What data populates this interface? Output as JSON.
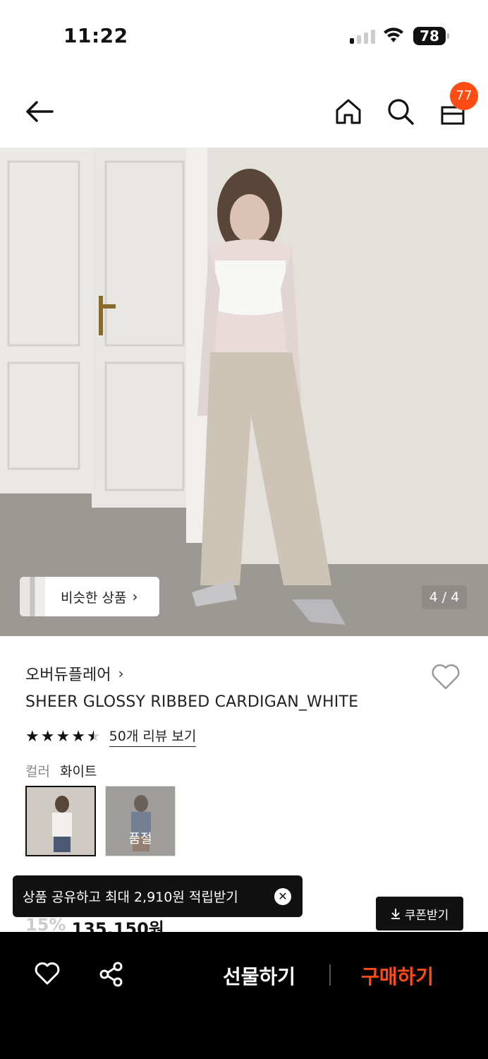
{
  "status_bar": {
    "time": "11:22",
    "battery": "78"
  },
  "nav": {
    "cart_count": "77"
  },
  "hero": {
    "similar_label": "비슷한 상품",
    "page_counter": "4 / 4"
  },
  "product": {
    "brand": "오버듀플레어",
    "name": "SHEER GLOSSY RIBBED CARDIGAN_WHITE",
    "rating": 4.5,
    "review_link": "50개 리뷰 보기",
    "color_label": "컬러",
    "color_value": "화이트",
    "swatches": [
      {
        "status": "selected"
      },
      {
        "status": "soldout",
        "label": "품절"
      }
    ],
    "discount": "15%",
    "price": "135,150원"
  },
  "tooltip": {
    "text": "상품 공유하고 최대 2,910원 적립받기"
  },
  "coupon": {
    "label": "쿠폰받기"
  },
  "bottom_bar": {
    "gift_label": "선물하기",
    "buy_label": "구매하기"
  },
  "colors": {
    "accent": "#ff4b14",
    "bar": "#000000"
  },
  "icons": [
    "back-arrow-icon",
    "home-icon",
    "search-icon",
    "shopping-bag-icon",
    "heart-icon",
    "share-icon",
    "close-icon",
    "download-icon"
  ]
}
